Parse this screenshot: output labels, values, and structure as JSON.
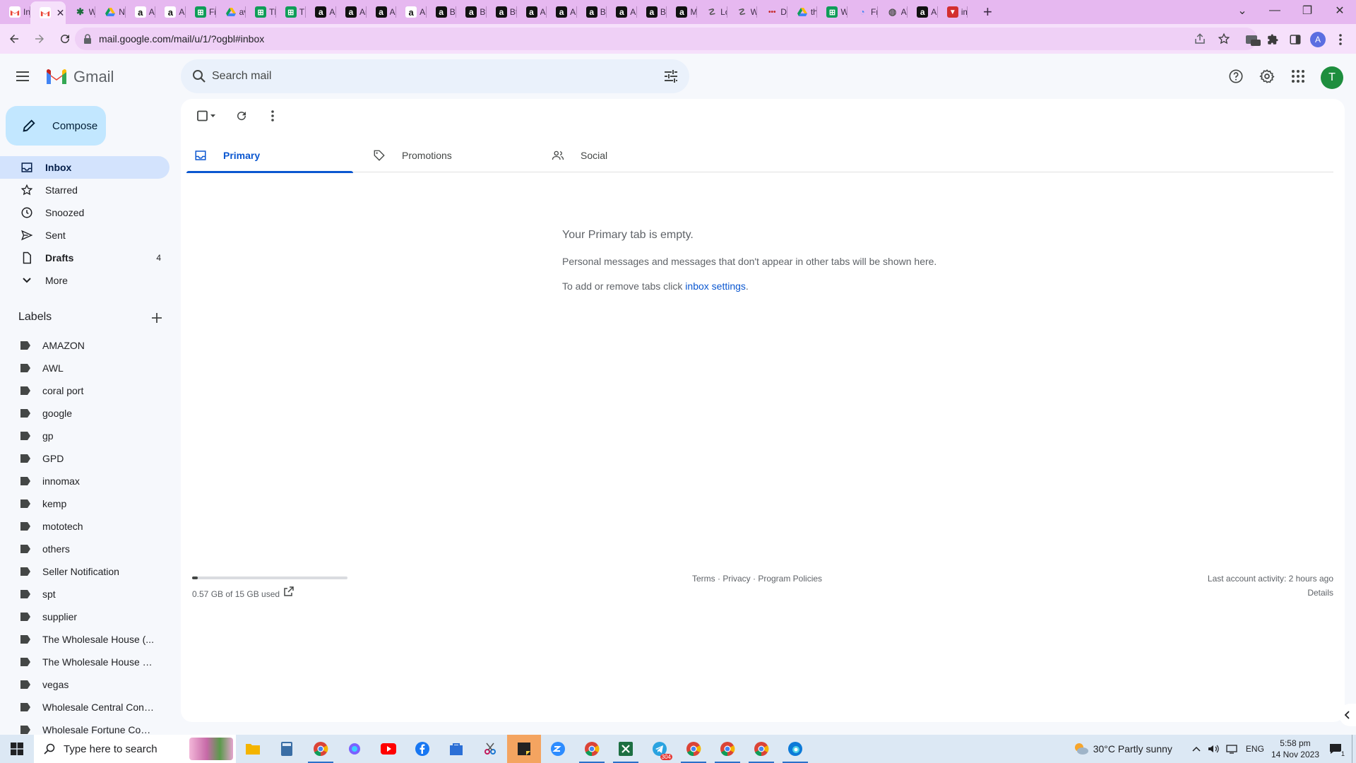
{
  "browser": {
    "tabs": [
      {
        "title": "Ini",
        "fav": "gmail"
      },
      {
        "title": "",
        "fav": "gmail",
        "active": true
      },
      {
        "title": "W",
        "fav": "puzzle"
      },
      {
        "title": "Nt",
        "fav": "drive"
      },
      {
        "title": "Ar",
        "fav": "amazon"
      },
      {
        "title": "Ar",
        "fav": "amazon"
      },
      {
        "title": "Fi",
        "fav": "sheets"
      },
      {
        "title": "av",
        "fav": "drive"
      },
      {
        "title": "Th",
        "fav": "sheets"
      },
      {
        "title": "TE",
        "fav": "sheets"
      },
      {
        "title": "Ar",
        "fav": "amazon-dark"
      },
      {
        "title": "Ar",
        "fav": "amazon-dark"
      },
      {
        "title": "Ar",
        "fav": "amazon-dark"
      },
      {
        "title": "Ar",
        "fav": "amazon"
      },
      {
        "title": "Bt",
        "fav": "amazon-dark"
      },
      {
        "title": "Bt",
        "fav": "amazon-dark"
      },
      {
        "title": "Bt",
        "fav": "amazon-dark"
      },
      {
        "title": "Ar",
        "fav": "amazon-dark"
      },
      {
        "title": "Ar",
        "fav": "amazon-dark"
      },
      {
        "title": "Bt",
        "fav": "amazon-dark"
      },
      {
        "title": "Ar",
        "fav": "amazon-dark"
      },
      {
        "title": "Bt",
        "fav": "amazon-dark"
      },
      {
        "title": "M",
        "fav": "amazon-dark"
      },
      {
        "title": "Lc",
        "fav": "script"
      },
      {
        "title": "W",
        "fav": "script"
      },
      {
        "title": "Dt",
        "fav": "dots"
      },
      {
        "title": "th",
        "fav": "drive"
      },
      {
        "title": "W",
        "fav": "sheets"
      },
      {
        "title": "Fr",
        "fav": "swirl"
      },
      {
        "title": "A\\",
        "fav": "globe"
      },
      {
        "title": "Ar",
        "fav": "amazon-dark"
      },
      {
        "title": "im",
        "fav": "red"
      }
    ],
    "url": "mail.google.com/mail/u/1/?ogbl#inbox",
    "profile_initial": "A"
  },
  "gmail": {
    "logo_text": "Gmail",
    "search_placeholder": "Search mail",
    "avatar_initial": "T",
    "compose_label": "Compose",
    "nav": [
      {
        "label": "Inbox",
        "icon": "inbox-icon",
        "selected": true,
        "count": ""
      },
      {
        "label": "Starred",
        "icon": "star-icon",
        "count": ""
      },
      {
        "label": "Snoozed",
        "icon": "clock-icon",
        "count": ""
      },
      {
        "label": "Sent",
        "icon": "send-icon",
        "count": ""
      },
      {
        "label": "Drafts",
        "icon": "draft-icon",
        "count": "4",
        "bold": true
      },
      {
        "label": "More",
        "icon": "chevron-down-icon",
        "count": ""
      }
    ],
    "labels_heading": "Labels",
    "labels": [
      "AMAZON",
      "AWL",
      "coral port",
      "google",
      "gp",
      "GPD",
      "innomax",
      "kemp",
      "mototech",
      "others",
      "Seller Notification",
      "spt",
      "supplier",
      "The Wholesale House (...",
      "The Wholesale House (T...",
      "vegas",
      "Wholesale Central Conn...",
      "Wholesale Fortune Com..."
    ],
    "category_tabs": [
      {
        "label": "Primary",
        "icon": "inbox-icon",
        "active": true
      },
      {
        "label": "Promotions",
        "icon": "tag-icon"
      },
      {
        "label": "Social",
        "icon": "people-icon"
      }
    ],
    "empty": {
      "title": "Your Primary tab is empty.",
      "description": "Personal messages and messages that don't appear in other tabs will be shown here.",
      "tip_prefix": "To add or remove tabs click ",
      "tip_link": "inbox settings",
      "tip_suffix": "."
    },
    "storage": {
      "text": "0.57 GB of 15 GB used",
      "used_fraction": 0.038
    },
    "footer_links": "Terms · Privacy · Program Policies",
    "last_activity": "Last account activity: 2 hours ago",
    "details": "Details"
  },
  "taskbar": {
    "search_placeholder": "Type here to search",
    "weather": "30°C  Partly sunny",
    "language": "ENG",
    "time": "5:58 pm",
    "date": "14 Nov 2023",
    "notification_count": "1",
    "telegram_badge": "304"
  },
  "colors": {
    "accent": "#0b57d0",
    "nav_selected": "#d3e3fd",
    "compose_bg": "#c2e7ff",
    "tabstrip_bg": "#e6b8f0"
  }
}
